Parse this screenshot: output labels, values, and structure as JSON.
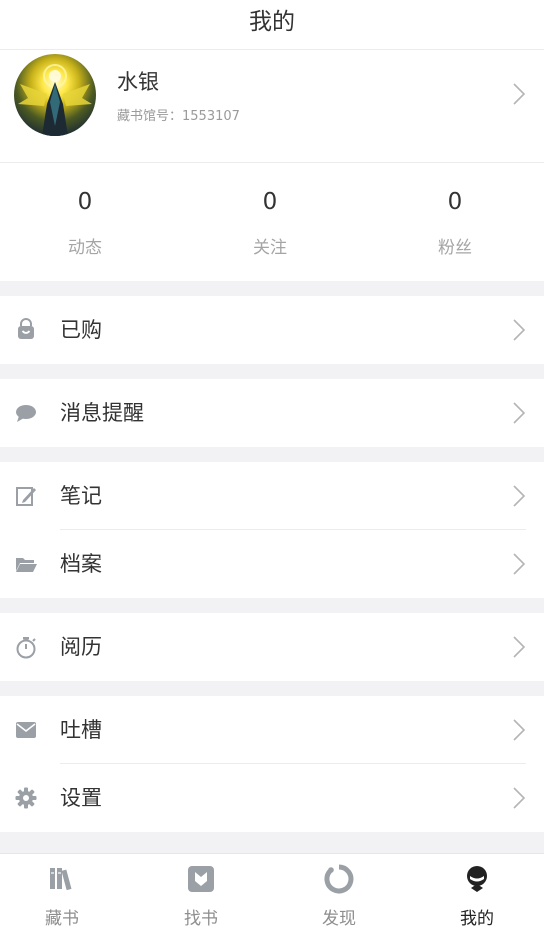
{
  "header": {
    "title": "我的"
  },
  "profile": {
    "name": "水银",
    "library_id": "藏书馆号：1553107",
    "avatar_icon": "avatar-image"
  },
  "stats": [
    {
      "value": "0",
      "label": "动态"
    },
    {
      "value": "0",
      "label": "关注"
    },
    {
      "value": "0",
      "label": "粉丝"
    }
  ],
  "menu": {
    "purchased": "已购",
    "messages": "消息提醒",
    "notes": "笔记",
    "archive": "档案",
    "history": "阅历",
    "feedback": "吐槽",
    "settings": "设置"
  },
  "tabbar": [
    {
      "label": "藏书",
      "icon": "bookshelf-icon"
    },
    {
      "label": "找书",
      "icon": "find-book-icon"
    },
    {
      "label": "发现",
      "icon": "discover-icon"
    },
    {
      "label": "我的",
      "icon": "profile-icon"
    }
  ],
  "colors": {
    "accent_text": "#333333",
    "muted_text": "#9a9a9a",
    "icon_gray": "#9aa0a6",
    "background": "#f2f2f4"
  }
}
